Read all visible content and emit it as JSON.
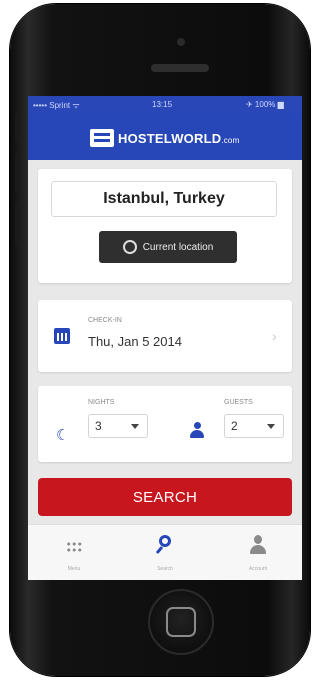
{
  "status_bar": {
    "carrier": "••••• Sprint ᯤ",
    "time": "13:15",
    "battery": "✈ 100% ▆"
  },
  "header": {
    "brand": "HOSTELWORLD",
    "brand_suffix": ".com"
  },
  "location": {
    "city_value": "Istanbul, Turkey",
    "current_location_label": "Current location"
  },
  "dates": {
    "checkin_label": "CHECK-IN",
    "checkin_value": "Thu, Jan 5 2014"
  },
  "guests": {
    "nights_label": "NIGHTS",
    "nights_value": "3",
    "guests_label": "GUESTS",
    "guests_value": "2"
  },
  "search": {
    "button_label": "SEARCH"
  },
  "tabs": [
    {
      "label": "Menu",
      "icon": "grid-icon"
    },
    {
      "label": "Search",
      "icon": "search-icon"
    },
    {
      "label": "Account",
      "icon": "account-icon"
    }
  ],
  "colors": {
    "brand_blue": "#2747b9",
    "search_red": "#c8161f",
    "background": "#e8e8e8"
  }
}
